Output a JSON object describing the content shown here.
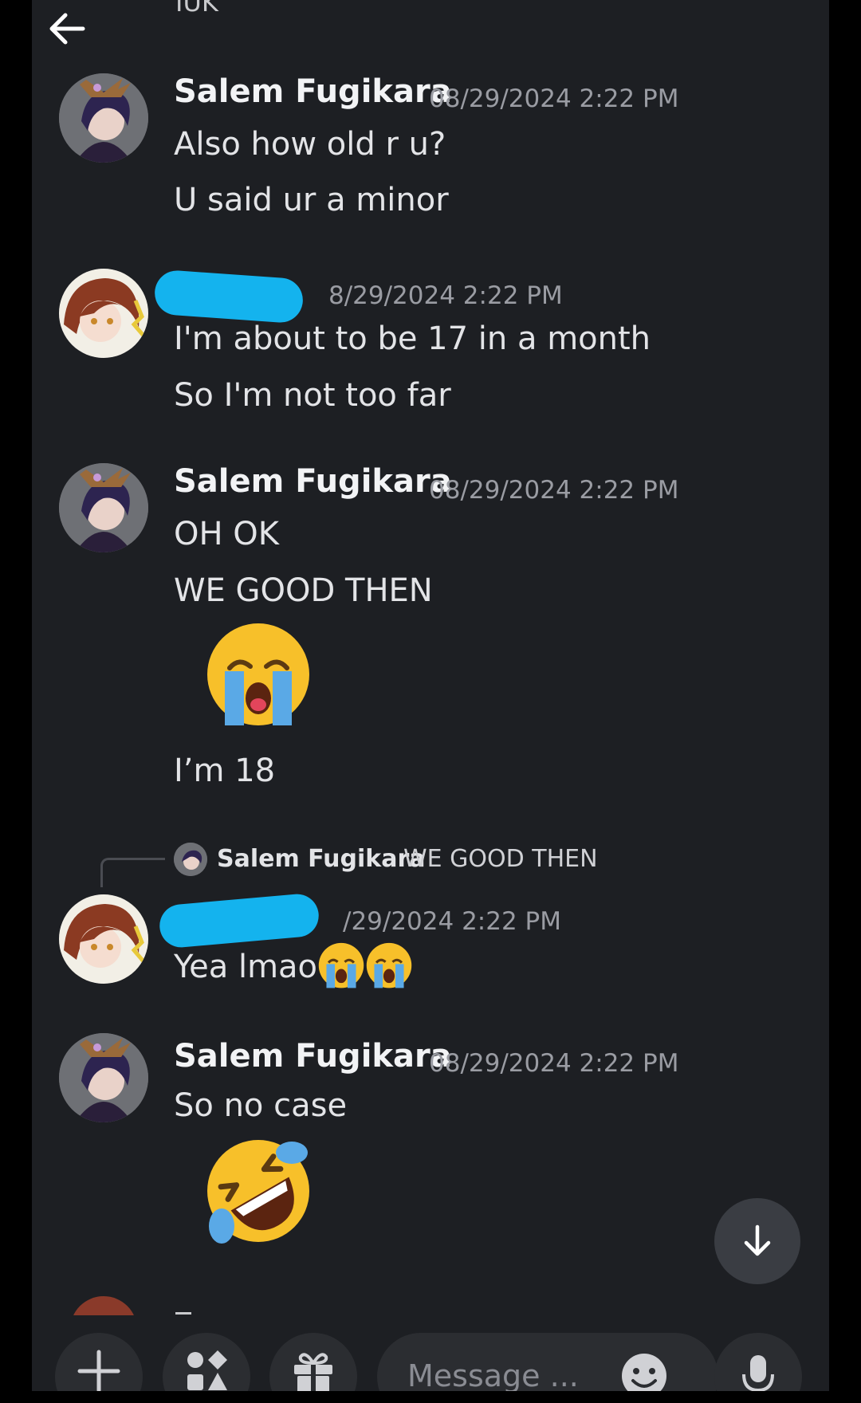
{
  "header": {
    "back_icon": "arrow-left-icon",
    "cut_off_text": "IUK"
  },
  "messages": [
    {
      "author": "Salem Fugikara",
      "timestamp": "08/29/2024 2:22 PM",
      "lines": [
        "Also how old r u?",
        "U said ur a minor"
      ]
    },
    {
      "author": "",
      "timestamp": "8/29/2024 2:22 PM",
      "lines": [
        "I'm about to be 17 in a month",
        "So I'm not too far"
      ]
    },
    {
      "author": "Salem Fugikara",
      "timestamp": "08/29/2024 2:22 PM",
      "lines": [
        "OH OK",
        "WE GOOD THEN",
        "I’m 18"
      ],
      "emoji": "loudly-crying-face"
    },
    {
      "reply": {
        "author": "Salem Fugikara",
        "text": "WE GOOD THEN"
      },
      "author": "",
      "timestamp": "/29/2024 2:22 PM",
      "lines": [
        "Yea lmao"
      ],
      "inline_emoji": [
        "loudly-crying-face",
        "loudly-crying-face"
      ]
    },
    {
      "author": "Salem Fugikara",
      "timestamp": "08/29/2024 2:22 PM",
      "lines": [
        "So no case"
      ],
      "emoji": "rolling-on-floor-laughing"
    }
  ],
  "composer": {
    "placeholder": "Message ...",
    "buttons": [
      "plus-icon",
      "apps-icon",
      "gift-icon",
      "emoji-icon",
      "microphone-icon"
    ]
  },
  "scroll_button_icon": "arrow-down-icon",
  "colors": {
    "background": "#1d1f23",
    "redaction": "#14b3ee",
    "emoji_yellow": "#f7c02a",
    "emoji_tears": "#5aa9e6"
  }
}
